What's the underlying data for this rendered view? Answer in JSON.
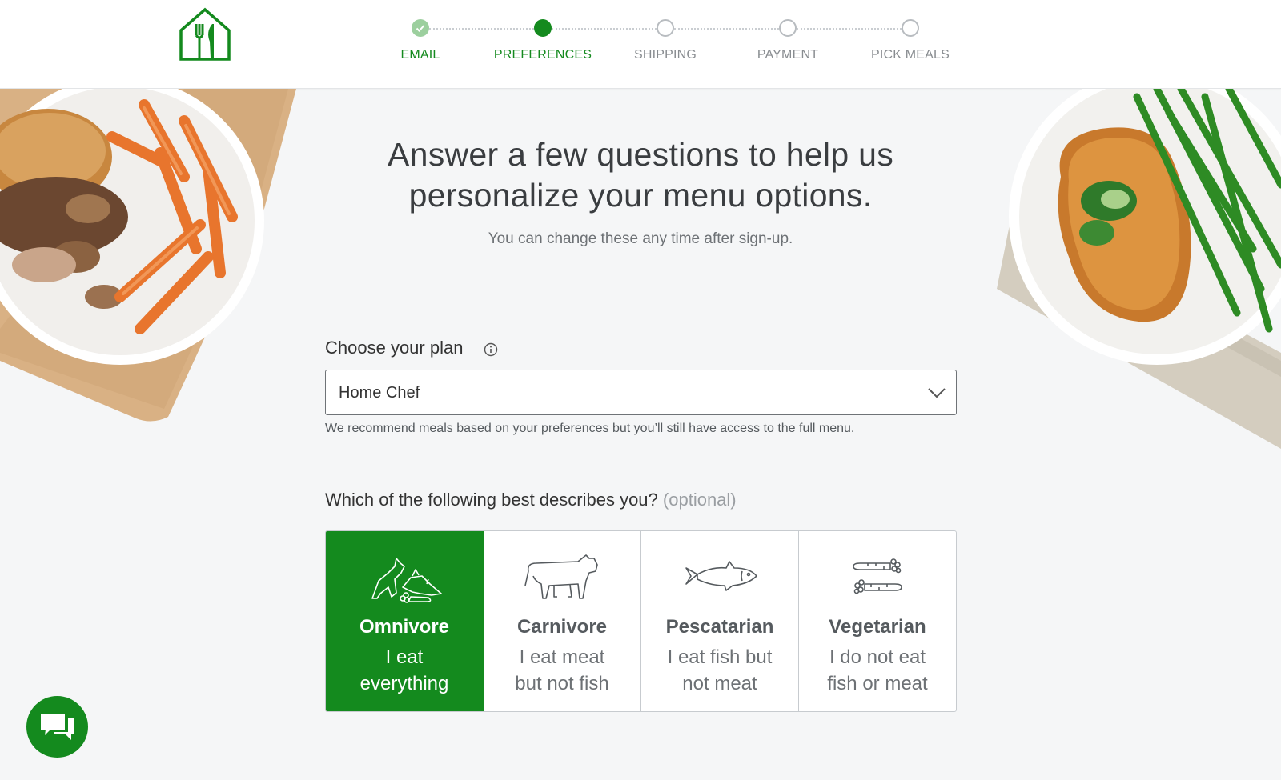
{
  "header": {
    "logo_icon": "home-chef-logo-icon",
    "steps": [
      {
        "label": "EMAIL",
        "state": "done"
      },
      {
        "label": "PREFERENCES",
        "state": "active"
      },
      {
        "label": "SHIPPING",
        "state": "todo"
      },
      {
        "label": "PAYMENT",
        "state": "todo"
      },
      {
        "label": "PICK MEALS",
        "state": "todo"
      }
    ]
  },
  "main": {
    "headline_line1": "Answer a few questions to help us",
    "headline_line2": "personalize your menu options.",
    "subhead": "You can change these any time after sign-up.",
    "plan": {
      "label": "Choose your plan",
      "selected": "Home Chef",
      "note": "We recommend meals based on your preferences but you’ll still have access to the full menu."
    },
    "diet": {
      "question": "Which of the following best describes you?",
      "optional": "(optional)",
      "options": [
        {
          "title": "Omnivore",
          "line1": "I eat",
          "line2": "everything",
          "icon": "animals-icon",
          "selected": true
        },
        {
          "title": "Carnivore",
          "line1": "I eat meat",
          "line2": "but not fish",
          "icon": "cow-icon",
          "selected": false
        },
        {
          "title": "Pescatarian",
          "line1": "I eat fish but",
          "line2": "not meat",
          "icon": "fish-icon",
          "selected": false
        },
        {
          "title": "Vegetarian",
          "line1": "I do not eat",
          "line2": "fish or meat",
          "icon": "carrots-icon",
          "selected": false
        }
      ]
    }
  },
  "colors": {
    "brand_green": "#148a1e",
    "done_green": "#9ccf9e",
    "background": "#f5f6f7"
  },
  "chat": {
    "icon": "chat-bubbles-icon"
  }
}
